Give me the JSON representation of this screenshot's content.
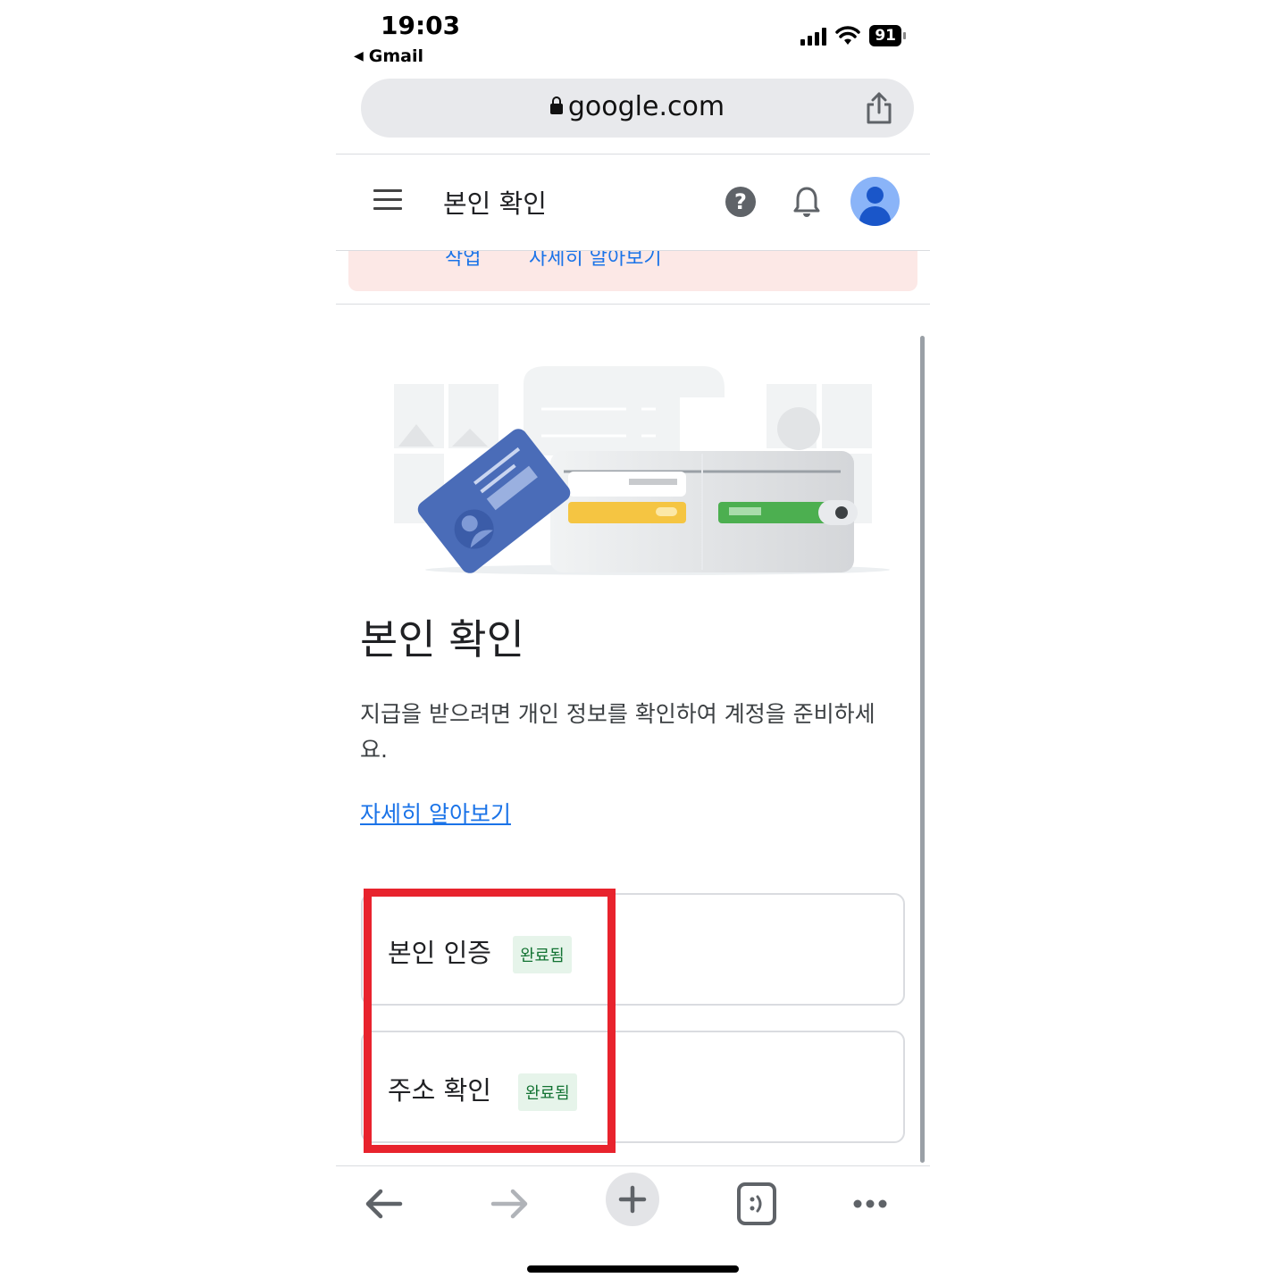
{
  "status_bar": {
    "time": "19:03",
    "back_app": "Gmail",
    "battery": "91"
  },
  "browser": {
    "url": "google.com"
  },
  "header": {
    "title": "본인 확인"
  },
  "banner": {
    "left_text": "작업",
    "right_text": "자세히 알아보기"
  },
  "main": {
    "title": "본인 확인",
    "description": "지급을 받으려면 개인 정보를 확인하여 계정을 준비하세요.",
    "learn_more": "자세히 알아보기"
  },
  "steps": [
    {
      "label": "본인 인증",
      "status": "완료됨"
    },
    {
      "label": "주소 확인",
      "status": "완료됨"
    }
  ],
  "colors": {
    "link": "#1a73e8",
    "badge_bg": "#e6f4ea",
    "badge_text": "#137333",
    "highlight": "#e8232d",
    "banner_bg": "#fce8e6"
  }
}
